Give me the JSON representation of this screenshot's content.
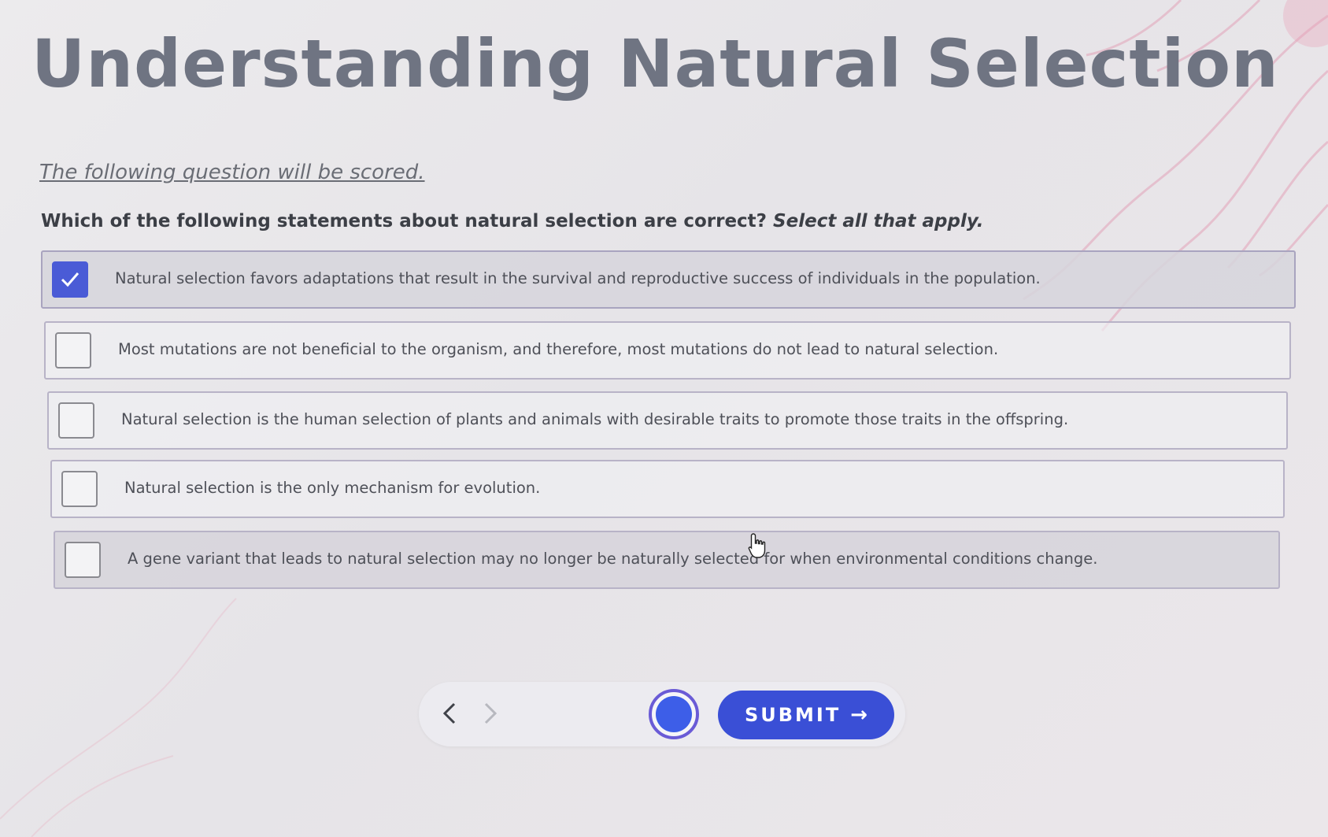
{
  "page": {
    "title": "Understanding Natural Selection",
    "scored_note": "The following question will be scored."
  },
  "question": {
    "prompt": "Which of the following statements about natural selection are correct?",
    "instruction": "Select all that apply."
  },
  "options": [
    {
      "label": "Natural selection favors adaptations that result in the survival and reproductive success of individuals in the population.",
      "checked": true
    },
    {
      "label": "Most mutations are not beneficial to the organism, and therefore, most mutations do not lead to natural selection.",
      "checked": false
    },
    {
      "label": "Natural selection is the human selection of plants and animals with desirable traits to promote those traits in the offspring.",
      "checked": false
    },
    {
      "label": "Natural selection is the only mechanism for evolution.",
      "checked": false
    },
    {
      "label": "A gene variant that leads to natural selection may no longer be naturally selected for when environmental conditions change.",
      "checked": false
    }
  ],
  "navigation": {
    "prev_icon": "chevron-left-icon",
    "next_icon": "chevron-right-icon",
    "submit_label": "SUBMIT",
    "submit_icon": "arrow-right-icon"
  },
  "colors": {
    "accent": "#3a4fd6",
    "checked": "#4a5bd6",
    "title": "#6f7482"
  }
}
